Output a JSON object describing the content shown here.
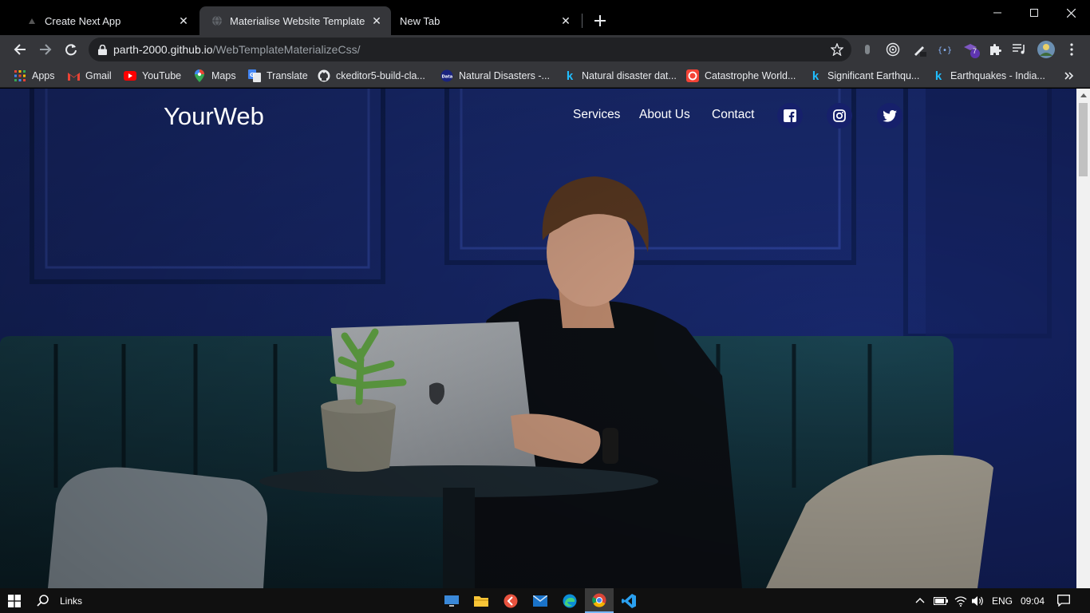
{
  "browser": {
    "tabs": [
      {
        "title": "Create Next App",
        "active": false,
        "icon": "nextjs-icon"
      },
      {
        "title": "Materialise Website Template",
        "active": true,
        "icon": "globe-icon"
      },
      {
        "title": "New Tab",
        "active": false,
        "icon": "none"
      }
    ],
    "address": {
      "host": "parth-2000.github.io",
      "path": "/WebTemplateMaterializeCss/"
    },
    "bookmarks": [
      {
        "label": "Apps",
        "icon": "apps-grid-icon"
      },
      {
        "label": "Gmail",
        "icon": "gmail-icon"
      },
      {
        "label": "YouTube",
        "icon": "youtube-icon"
      },
      {
        "label": "Maps",
        "icon": "maps-icon"
      },
      {
        "label": "Translate",
        "icon": "translate-icon"
      },
      {
        "label": "ckeditor5-build-cla...",
        "icon": "github-icon"
      },
      {
        "label": "Natural Disasters -...",
        "icon": "data-icon"
      },
      {
        "label": "Natural disaster dat...",
        "icon": "kaggle-icon"
      },
      {
        "label": "Catastrophe World...",
        "icon": "catastrophe-icon"
      },
      {
        "label": "Significant Earthqu...",
        "icon": "kaggle-icon"
      },
      {
        "label": "Earthquakes - India...",
        "icon": "kaggle-icon"
      }
    ],
    "extension_badge": "7"
  },
  "site": {
    "brand": "YourWeb",
    "nav": [
      {
        "label": "Services"
      },
      {
        "label": "About Us"
      },
      {
        "label": "Contact"
      }
    ],
    "social": [
      "facebook-icon",
      "instagram-icon",
      "twitter-icon"
    ]
  },
  "taskbar": {
    "search_label": "Links",
    "language": "ENG",
    "time": "09:04"
  },
  "colors": {
    "hero_wall": "#1c2d6e",
    "social_bg": "#16206b",
    "tab_active": "#35363a"
  }
}
